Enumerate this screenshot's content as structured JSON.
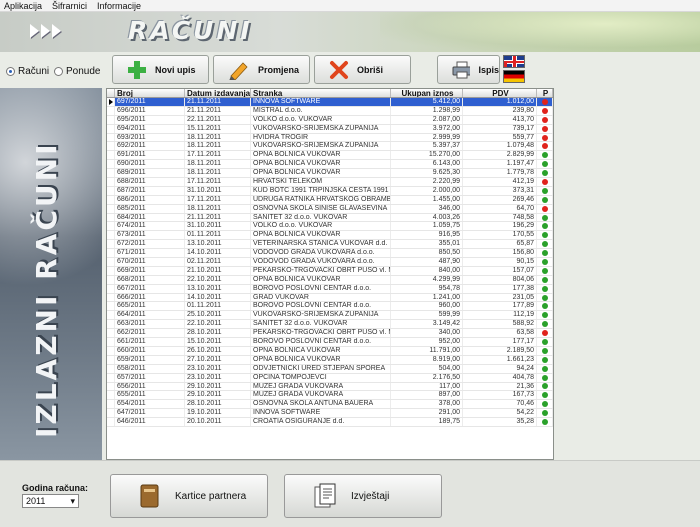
{
  "menu": [
    "Aplikacija",
    "Šifrarnici",
    "Informacije"
  ],
  "banner": {
    "title": "RAČUNI"
  },
  "mode": {
    "racuni": "Računi",
    "ponude": "Ponude",
    "selected": "racuni"
  },
  "toolbar": {
    "new": "Novi upis",
    "edit": "Promjena",
    "delete": "Obriši",
    "print": "Ispis"
  },
  "side_title": "IZLAZNI RAČUNI",
  "grid": {
    "columns": [
      "Broj",
      "Datum izdavanja",
      "Stranka",
      "Ukupan iznos",
      "PDV",
      "P"
    ],
    "rows": [
      [
        "697/2011",
        "21.11.2011",
        "INNOVA SOFTWARE",
        "5.412,00",
        "1.012,00",
        "red"
      ],
      [
        "696/2011",
        "21.11.2011",
        "MISTRAL d.o.o.",
        "1.298,99",
        "239,80",
        "red"
      ],
      [
        "695/2011",
        "22.11.2011",
        "VOLKO d.o.o. VUKOVAR",
        "2.087,00",
        "413,70",
        "red"
      ],
      [
        "694/2011",
        "15.11.2011",
        "VUKOVARSKO-SRIJEMSKA ŽUPANIJA",
        "3.972,00",
        "739,17",
        "red"
      ],
      [
        "693/2011",
        "18.11.2011",
        "HVIDRA TROGIR",
        "2.999,99",
        "559,77",
        "red"
      ],
      [
        "692/2011",
        "18.11.2011",
        "VUKOVARSKO-SRIJEMSKA ŽUPANIJA",
        "5.397,37",
        "1.079,48",
        "red"
      ],
      [
        "691/2011",
        "17.11.2011",
        "OPNA BOLNICA VUKOVAR",
        "15.270,00",
        "2.829,99",
        "green"
      ],
      [
        "690/2011",
        "18.11.2011",
        "OPNA BOLNICA VUKOVAR",
        "6.143,00",
        "1.197,47",
        "green"
      ],
      [
        "689/2011",
        "18.11.2011",
        "OPNA BOLNICA VUKOVAR",
        "9.625,30",
        "1.779,78",
        "green"
      ],
      [
        "688/2011",
        "17.11.2011",
        "HRVATSKI TELEKOM",
        "2.220,99",
        "412,19",
        "red"
      ],
      [
        "687/2011",
        "31.10.2011",
        "KUD BOTC 1991 TRPINJSKA CESTA 1991",
        "2.000,00",
        "373,31",
        "green"
      ],
      [
        "686/2011",
        "17.11.2011",
        "UDRUGA RATNIKA HRVATSKOG OBRAMBENOG ...",
        "1.455,00",
        "269,46",
        "green"
      ],
      [
        "685/2011",
        "18.11.2011",
        "OSNOVNA ŠKOLA SINIŠE GLAVAŠEVINA",
        "346,00",
        "64,70",
        "red"
      ],
      [
        "684/2011",
        "21.11.2011",
        "SANITET 32 d.o.o. VUKOVAR",
        "4.003,26",
        "748,58",
        "green"
      ],
      [
        "674/2011",
        "31.10.2011",
        "VOLKO d.o.o. VUKOVAR",
        "1.059,75",
        "196,29",
        "green"
      ],
      [
        "673/2011",
        "01.11.2011",
        "OPNA BOLNICA VUKOVAR",
        "916,95",
        "170,55",
        "green"
      ],
      [
        "672/2011",
        "13.10.2011",
        "VETERINARSKA STANICA VUKOVAR d.d.",
        "355,01",
        "65,87",
        "green"
      ],
      [
        "671/2011",
        "14.10.2011",
        "VODOVOD GRADA VUKOVARA d.o.o.",
        "850,50",
        "156,80",
        "green"
      ],
      [
        "670/2011",
        "02.11.2011",
        "VODOVOD GRADA VUKOVARA d.o.o.",
        "487,90",
        "90,15",
        "green"
      ],
      [
        "669/2011",
        "21.10.2011",
        "PEKARSKO-TRGOVAČKI OBRT PUŠO vl. MARIN ...",
        "840,00",
        "157,07",
        "green"
      ],
      [
        "668/2011",
        "22.10.2011",
        "OPNA BOLNICA VUKOVAR",
        "4.299,99",
        "804,06",
        "green"
      ],
      [
        "667/2011",
        "13.10.2011",
        "BOROVO POSLOVNI CENTAR d.o.o.",
        "954,78",
        "177,38",
        "green"
      ],
      [
        "666/2011",
        "14.10.2011",
        "GRAD VUKOVAR",
        "1.241,00",
        "231,05",
        "green"
      ],
      [
        "665/2011",
        "01.11.2011",
        "BOROVO POSLOVNI CENTAR d.o.o.",
        "960,00",
        "177,89",
        "green"
      ],
      [
        "664/2011",
        "25.10.2011",
        "VUKOVARSKO-SRIJEMSKA ŽUPANIJA",
        "599,99",
        "112,19",
        "green"
      ],
      [
        "663/2011",
        "22.10.2011",
        "SANITET 32 d.o.o. VUKOVAR",
        "3.149,42",
        "588,92",
        "green"
      ],
      [
        "662/2011",
        "28.10.2011",
        "PEKARSKO-TRGOVAČKI OBRT PUŠO vl. MARIN ...",
        "340,00",
        "63,58",
        "red"
      ],
      [
        "661/2011",
        "15.10.2011",
        "BOROVO POSLOVNI CENTAR d.o.o.",
        "952,00",
        "177,17",
        "green"
      ],
      [
        "660/2011",
        "26.10.2011",
        "OPNA BOLNICA VUKOVAR",
        "11.791,00",
        "2.189,50",
        "green"
      ],
      [
        "659/2011",
        "27.10.2011",
        "OPNA BOLNICA VUKOVAR",
        "8.919,00",
        "1.661,23",
        "green"
      ],
      [
        "658/2011",
        "23.10.2011",
        "ODVJETNIČKI URED STJEPAN ŠPOREA",
        "504,00",
        "94,24",
        "green"
      ],
      [
        "657/2011",
        "23.10.2011",
        "OPĆINA TOMPOJEVCI",
        "2.176,50",
        "404,78",
        "green"
      ],
      [
        "656/2011",
        "29.10.2011",
        "MUZEJ GRADA VUKOVARA",
        "117,00",
        "21,36",
        "green"
      ],
      [
        "655/2011",
        "29.10.2011",
        "MUZEJ GRADA VUKOVARA",
        "897,00",
        "167,73",
        "green"
      ],
      [
        "654/2011",
        "28.10.2011",
        "OSNOVNA ŠKOLA ANTUNA BAUERA",
        "378,00",
        "70,46",
        "green"
      ],
      [
        "647/2011",
        "19.10.2011",
        "INNOVA SOFTWARE",
        "291,00",
        "54,22",
        "green"
      ],
      [
        "646/2011",
        "20.10.2011",
        "CROATIA OSIGURANJE d.d.",
        "189,75",
        "35,28",
        "green"
      ]
    ]
  },
  "bottom": {
    "year_label": "Godina računa:",
    "year_value": "2011",
    "cards": "Kartice partnera",
    "reports": "Izvještaji"
  },
  "colors": {
    "selection": "#2f5fd0",
    "paid": "#2aa12a",
    "unpaid": "#e0231c"
  }
}
